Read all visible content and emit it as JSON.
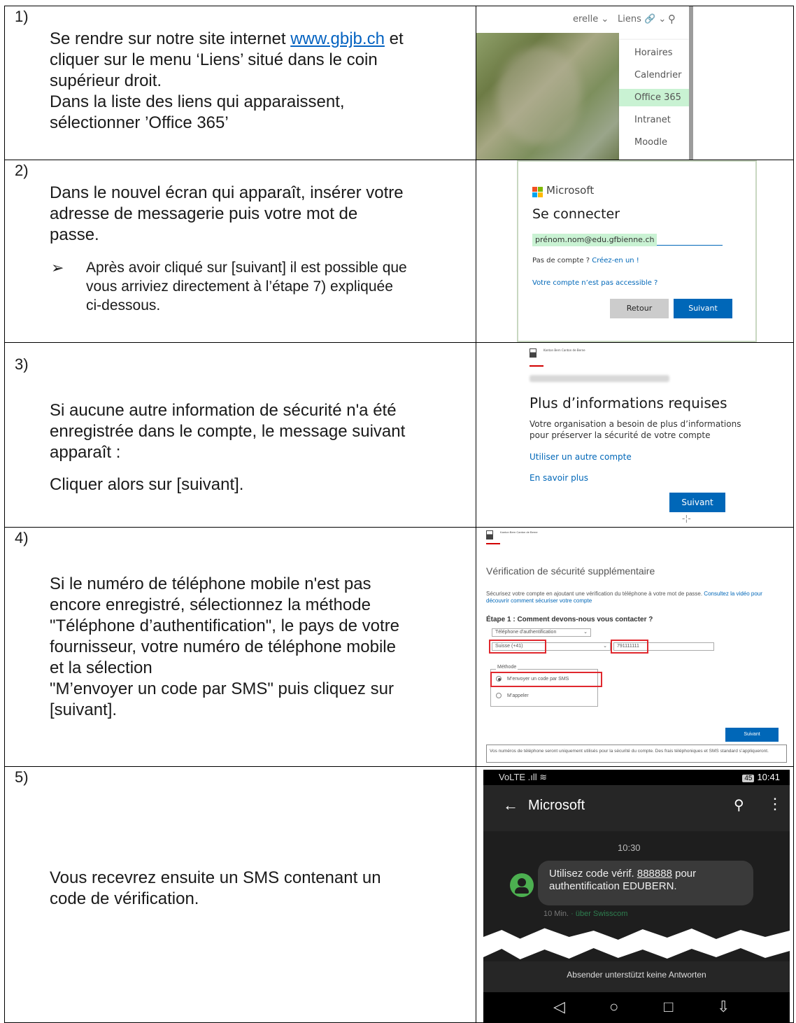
{
  "steps": [
    {
      "num": "1)",
      "lines": [
        "Se rendre sur notre site internet ",
        "www.gbjb.ch",
        " et",
        "cliquer sur le menu ‘Liens’ situé dans le coin",
        "supérieur droit.",
        "Dans la liste des liens qui apparaissent,",
        "sélectionner ’Office 365’"
      ]
    },
    {
      "num": "2)",
      "lines": [
        "Dans le nouvel écran qui apparaît, insérer votre",
        "adresse de messagerie puis votre mot de",
        "passe."
      ],
      "bullet": [
        "Après avoir cliqué sur [suivant] il est possible que",
        "vous arriviez directement à l’étape 7) expliquée",
        "ci-dessous."
      ]
    },
    {
      "num": "3)",
      "lines": [
        "Si aucune autre information de sécurité n'a été",
        "enregistrée dans le compte, le message suivant",
        "apparaît :"
      ],
      "line2": "Cliquer alors sur [suivant]."
    },
    {
      "num": "4)",
      "lines": [
        "Si le numéro de téléphone mobile n'est pas",
        "encore enregistré, sélectionnez la méthode",
        "\"Téléphone d’authentification\", le pays de votre",
        "fournisseur, votre numéro de téléphone mobile",
        "et la sélection",
        "\"M’envoyer un code par SMS\" puis cliquez sur",
        "[suivant]."
      ]
    },
    {
      "num": "5)",
      "lines": [
        "Vous recevrez ensuite un SMS contenant un",
        "code de vérification."
      ]
    }
  ],
  "shot1": {
    "topbar": [
      "erelle ⌄",
      "Liens 🔗 ⌄",
      "⚲"
    ],
    "items": [
      "Horaires",
      "Calendrier",
      "Office 365",
      "Intranet",
      "Moodle"
    ],
    "highlight_color": "#c9f2d3"
  },
  "shot2": {
    "brand": "Microsoft",
    "title": "Se connecter",
    "email": "prénom.nom@edu.gfbienne.ch",
    "no_account": "Pas de compte ? ",
    "create": "Créez-en un !",
    "inaccessible": "Votre compte n’est pas accessible ?",
    "back": "Retour",
    "next": "Suivant",
    "accent": "#0067b8"
  },
  "shot3": {
    "canton": "Kanton Bern\nCanton de Berne",
    "title": "Plus d’informations requises",
    "body": "Votre organisation a besoin de plus d’informations pour préserver la sécurité de votre compte",
    "link1": "Utiliser un autre compte",
    "link2": "En savoir plus",
    "next": "Suivant"
  },
  "shot4": {
    "canton": "Kanton Bern\nCanton de Berne",
    "title": "Vérification de sécurité supplémentaire",
    "intro": "Sécurisez votre compte en ajoutant une vérification du téléphone à votre mot de passe. ",
    "intro_link": "Consultez la vidéo pour découvrir comment sécuriser votre compte",
    "step": "Étape 1 : Comment devons-nous vous contacter ?",
    "method_select": "Téléphone d'authentification",
    "country": "Suisse (+41)",
    "phone": "791111111",
    "legend": "Méthode",
    "opt_sms": "M’envoyer un code par SMS",
    "opt_call": "M’appeler",
    "next": "Suivant",
    "footer": "Vos numéros de téléphone seront uniquement utilisés pour la sécurité du compte. Des frais téléphoniques et SMS standard s’appliqueront.",
    "red": "#e0282e"
  },
  "shot5": {
    "status_left": "VoLTE .ıll ≋",
    "battery": "45",
    "clock": "10:41",
    "contact": "Microsoft",
    "msg_time": "10:30",
    "msg_pre": "Utilisez code vérif. ",
    "msg_code": "888888",
    "msg_post": " pour authentification EDUBERN.",
    "meta_time": "10 Min.",
    "meta_via": " · über Swisscom",
    "noreply": "Absender unterstützt keine Antworten",
    "avatar_color": "#4caf50"
  }
}
